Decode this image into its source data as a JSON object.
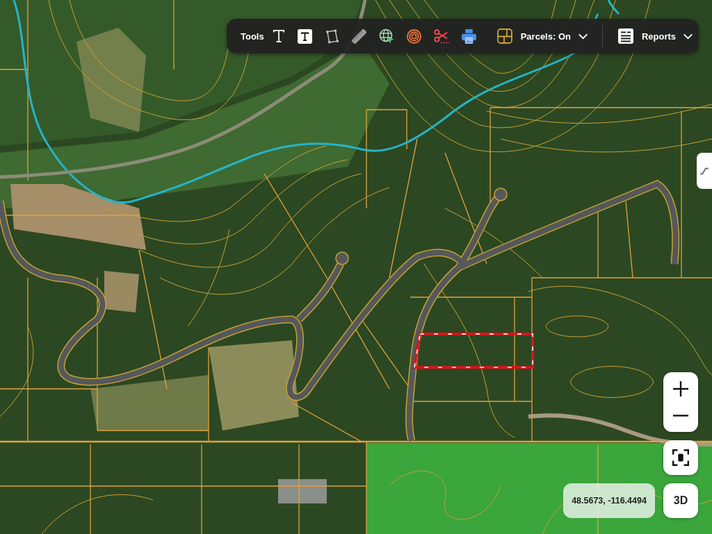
{
  "toolbar": {
    "label": "Tools",
    "parcels_menu": "Parcels: On",
    "reports_menu": "Reports"
  },
  "map_controls": {
    "coordinates": "48.5673, -116.4494",
    "view_mode_button": "3D"
  }
}
